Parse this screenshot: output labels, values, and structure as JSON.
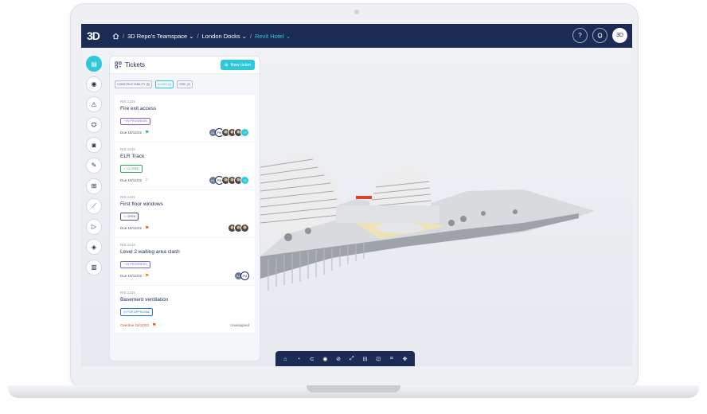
{
  "app": {
    "logo": "3D"
  },
  "breadcrumb": {
    "teamspace": "3D Repo's Teamspace ⌄",
    "project": "London Docks ⌄",
    "model": "Revit Hotel ⌄",
    "sep": "/"
  },
  "topbar": {
    "help": "?",
    "bell": "🔔",
    "user_initials": "3D"
  },
  "rail": [
    {
      "name": "tickets",
      "glyph": "▤",
      "active": true
    },
    {
      "name": "pin",
      "glyph": "◉"
    },
    {
      "name": "warning",
      "glyph": "⚠"
    },
    {
      "name": "groups",
      "glyph": "⛭"
    },
    {
      "name": "camera",
      "glyph": "◙"
    },
    {
      "name": "pencil",
      "glyph": "✎"
    },
    {
      "name": "tree",
      "glyph": "⊞"
    },
    {
      "name": "measure",
      "glyph": "⟋"
    },
    {
      "name": "sequences",
      "glyph": "▷"
    },
    {
      "name": "layers",
      "glyph": "◈"
    },
    {
      "name": "book",
      "glyph": "▥"
    }
  ],
  "panel": {
    "title": "Tickets",
    "new_ticket": "New ticket",
    "filters": [
      "CONSTRUCTABILITY (5)",
      "CLASH (4)",
      "RISK (2)"
    ]
  },
  "tickets": [
    {
      "id": "RIS:1234",
      "title": "Fire exit access",
      "status": "IN PROGRESS",
      "due": "Due 15/12/22"
    },
    {
      "id": "RIS:1234",
      "title": "ELR Track",
      "status": "CLOSED",
      "due": "Due 15/12/22"
    },
    {
      "id": "RIS:1234",
      "title": "First floor windows",
      "status": "OPEN",
      "due": "Due 15/12/22"
    },
    {
      "id": "RIS:1234",
      "title": "Level 2 waiting area clash",
      "status": "IN PROGRESS",
      "due": "Due 15/12/22"
    },
    {
      "id": "RIS:1234",
      "title": "Basement ventilation",
      "status": "FOR APPROVAL",
      "due": "Overdue 15/12/22",
      "assignee": "Unassigned"
    }
  ],
  "avatars": {
    "a1": "AL",
    "a2": "PM",
    "plus7": "+7",
    "plus1": "+1"
  },
  "toolbar": [
    "⌂",
    "◔",
    "⊂",
    "◉",
    "⊘",
    "⤢",
    "⊟",
    "⊡",
    "⌗",
    "✥"
  ],
  "colors": {
    "navy": "#1c2b54",
    "accent": "#2fc8d8"
  }
}
